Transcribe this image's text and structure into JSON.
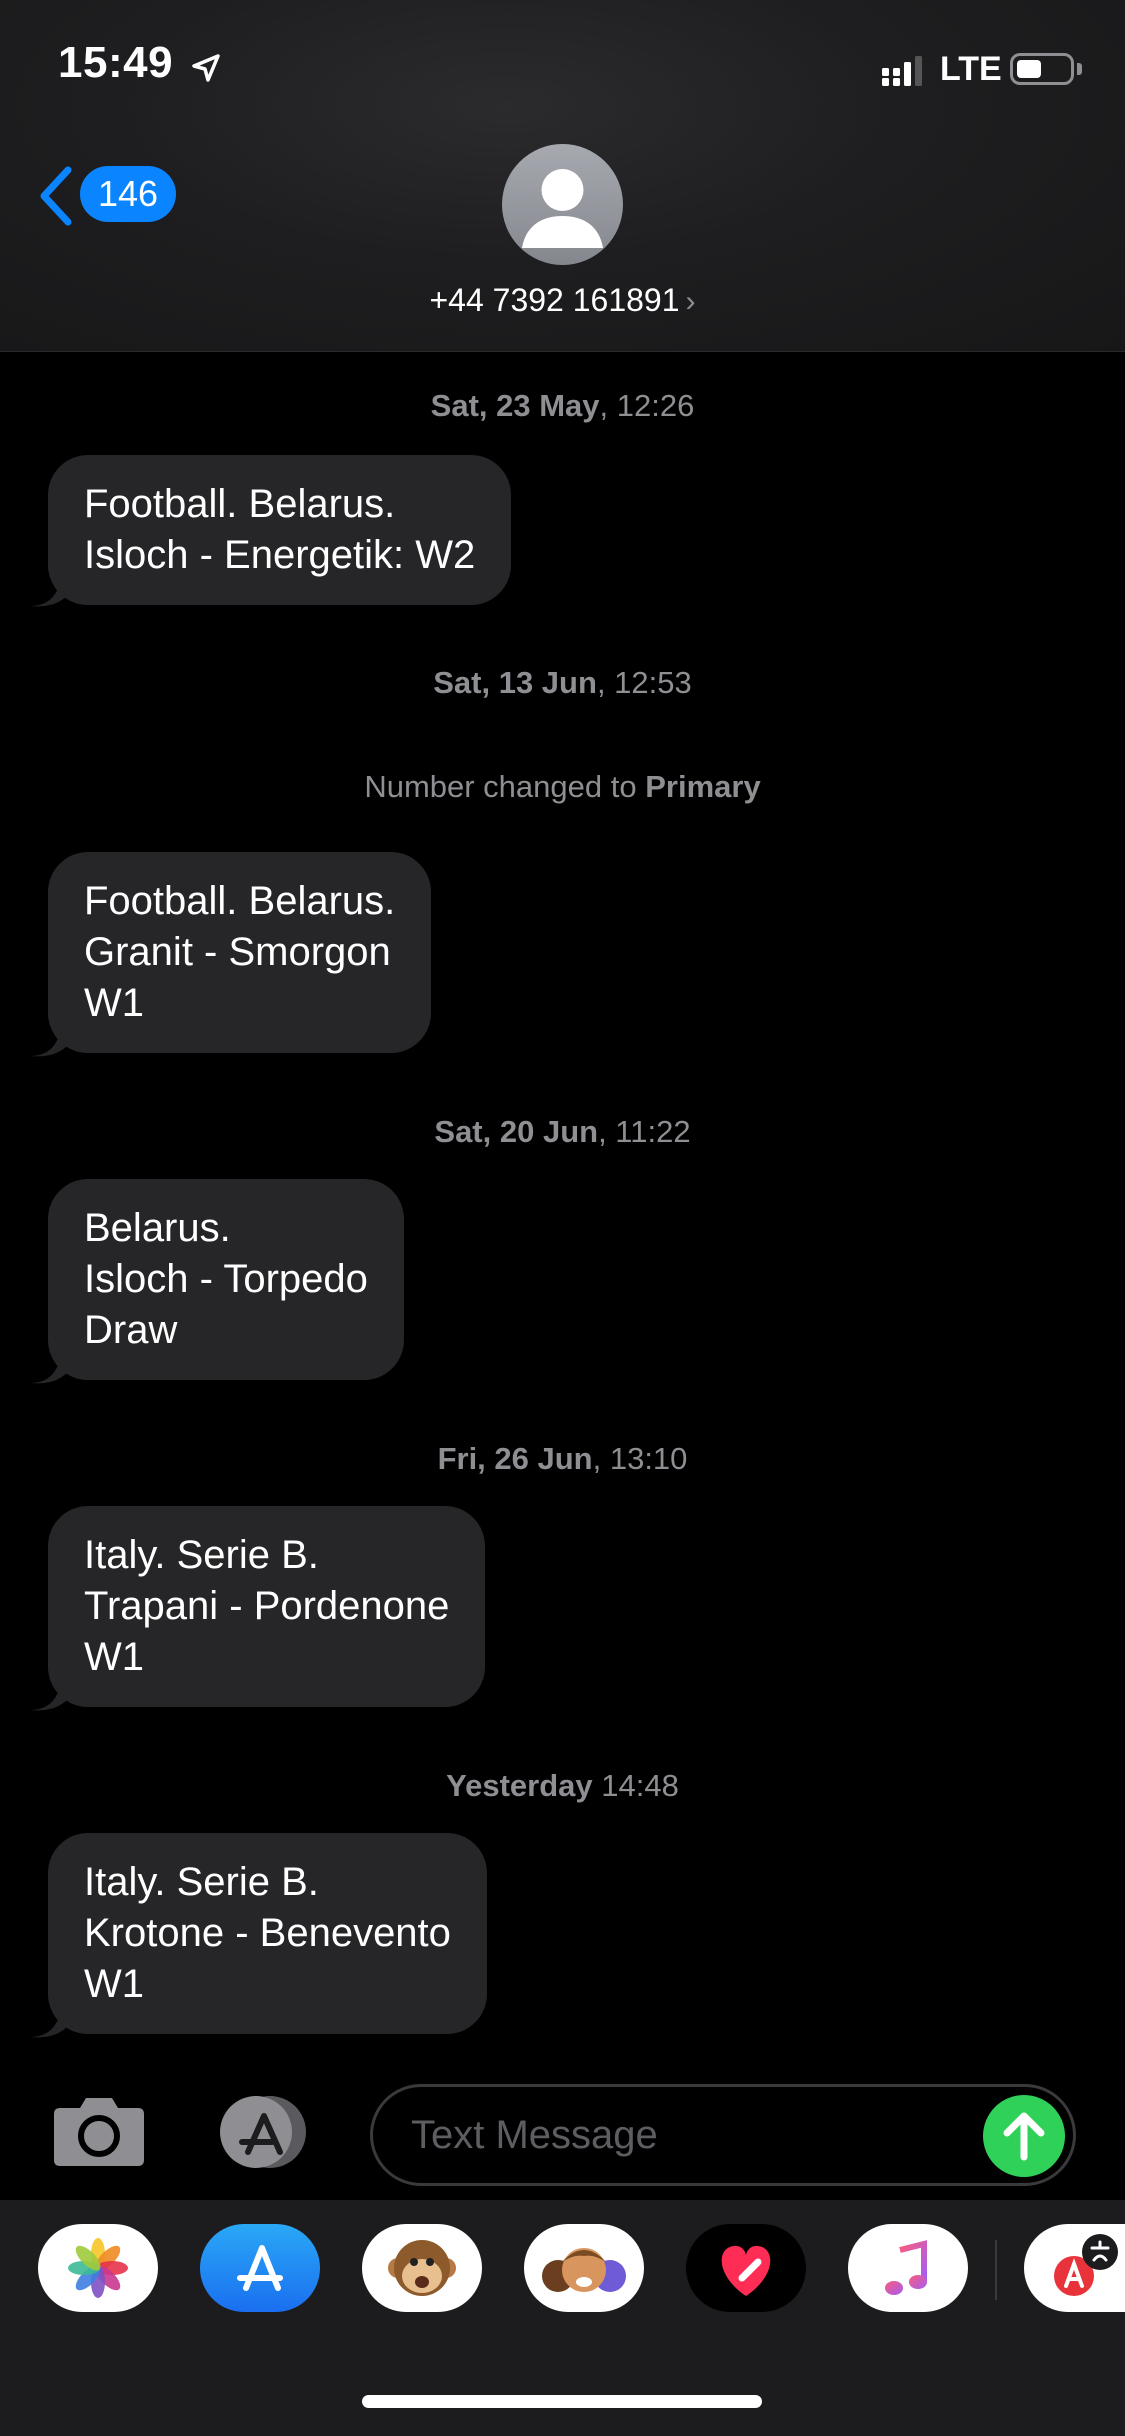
{
  "status_bar": {
    "time": "15:49",
    "network": "LTE"
  },
  "header": {
    "back_count": "146",
    "contact": "+44 7392 161891",
    "contact_chevron": "›"
  },
  "thread": {
    "groups": [
      {
        "date_bold": "Sat, 23 May",
        "time": ", 12:26",
        "lines": [
          "Football. Belarus.",
          "Isloch - Energetik: W2"
        ]
      },
      {
        "date_bold": "Sat, 13 Jun",
        "time": ", 12:53",
        "note_prefix": "Number changed to ",
        "note_bold": "Primary",
        "lines": [
          "Football. Belarus.",
          "Granit - Smorgon",
          "W1"
        ]
      },
      {
        "date_bold": "Sat, 20 Jun",
        "time": ", 11:22",
        "lines": [
          "Belarus.",
          "Isloch - Torpedo",
          "Draw"
        ]
      },
      {
        "date_bold": "Fri, 26 Jun",
        "time": ", 13:10",
        "lines": [
          "Italy. Serie B.",
          "Trapani - Pordenone",
          "W1"
        ]
      },
      {
        "date_bold": "Yesterday",
        "time": " 14:48",
        "lines": [
          "Italy. Serie B.",
          "Krotone - Benevento",
          "W1"
        ]
      }
    ]
  },
  "composer": {
    "placeholder": "Text Message"
  },
  "drawer": {
    "apps": [
      "photos-icon",
      "app-store-icon",
      "animoji-icon",
      "memoji-icon",
      "digital-touch-icon",
      "music-icon",
      "translate-icon"
    ]
  },
  "colors": {
    "accent": "#0a84ff",
    "bubble": "#262628",
    "send": "#30d158",
    "secondary_text": "#8e8e93"
  }
}
